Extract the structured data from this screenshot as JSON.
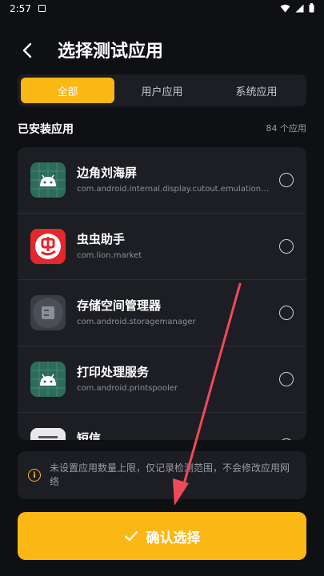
{
  "status_bar": {
    "time": "2:57"
  },
  "header": {
    "title": "选择测试应用"
  },
  "tabs": [
    {
      "label": "全部",
      "active": true
    },
    {
      "label": "用户应用",
      "active": false
    },
    {
      "label": "系统应用",
      "active": false
    }
  ],
  "section": {
    "title": "已安装应用",
    "count": "84 个应用"
  },
  "apps": [
    {
      "name": "边角刘海屏",
      "package": "com.android.internal.display.cutout.emulation…",
      "icon": "android-icon"
    },
    {
      "name": "虫虫助手",
      "package": "com.lion.market",
      "icon": "chongchong-icon"
    },
    {
      "name": "存储空间管理器",
      "package": "com.android.storagemanager",
      "icon": "storage-icon"
    },
    {
      "name": "打印处理服务",
      "package": "com.android.printspooler",
      "icon": "android-icon"
    },
    {
      "name": "短信",
      "package": "",
      "icon": "sms-icon"
    }
  ],
  "info": {
    "text": "未设置应用数量上限，仅记录检测范围，不会修改应用网络"
  },
  "confirm": {
    "label": "确认选择"
  },
  "colors": {
    "accent": "#fbb714",
    "background": "#0f1013",
    "card": "#1c1e23",
    "annotation_arrow": "#f04a5a"
  }
}
